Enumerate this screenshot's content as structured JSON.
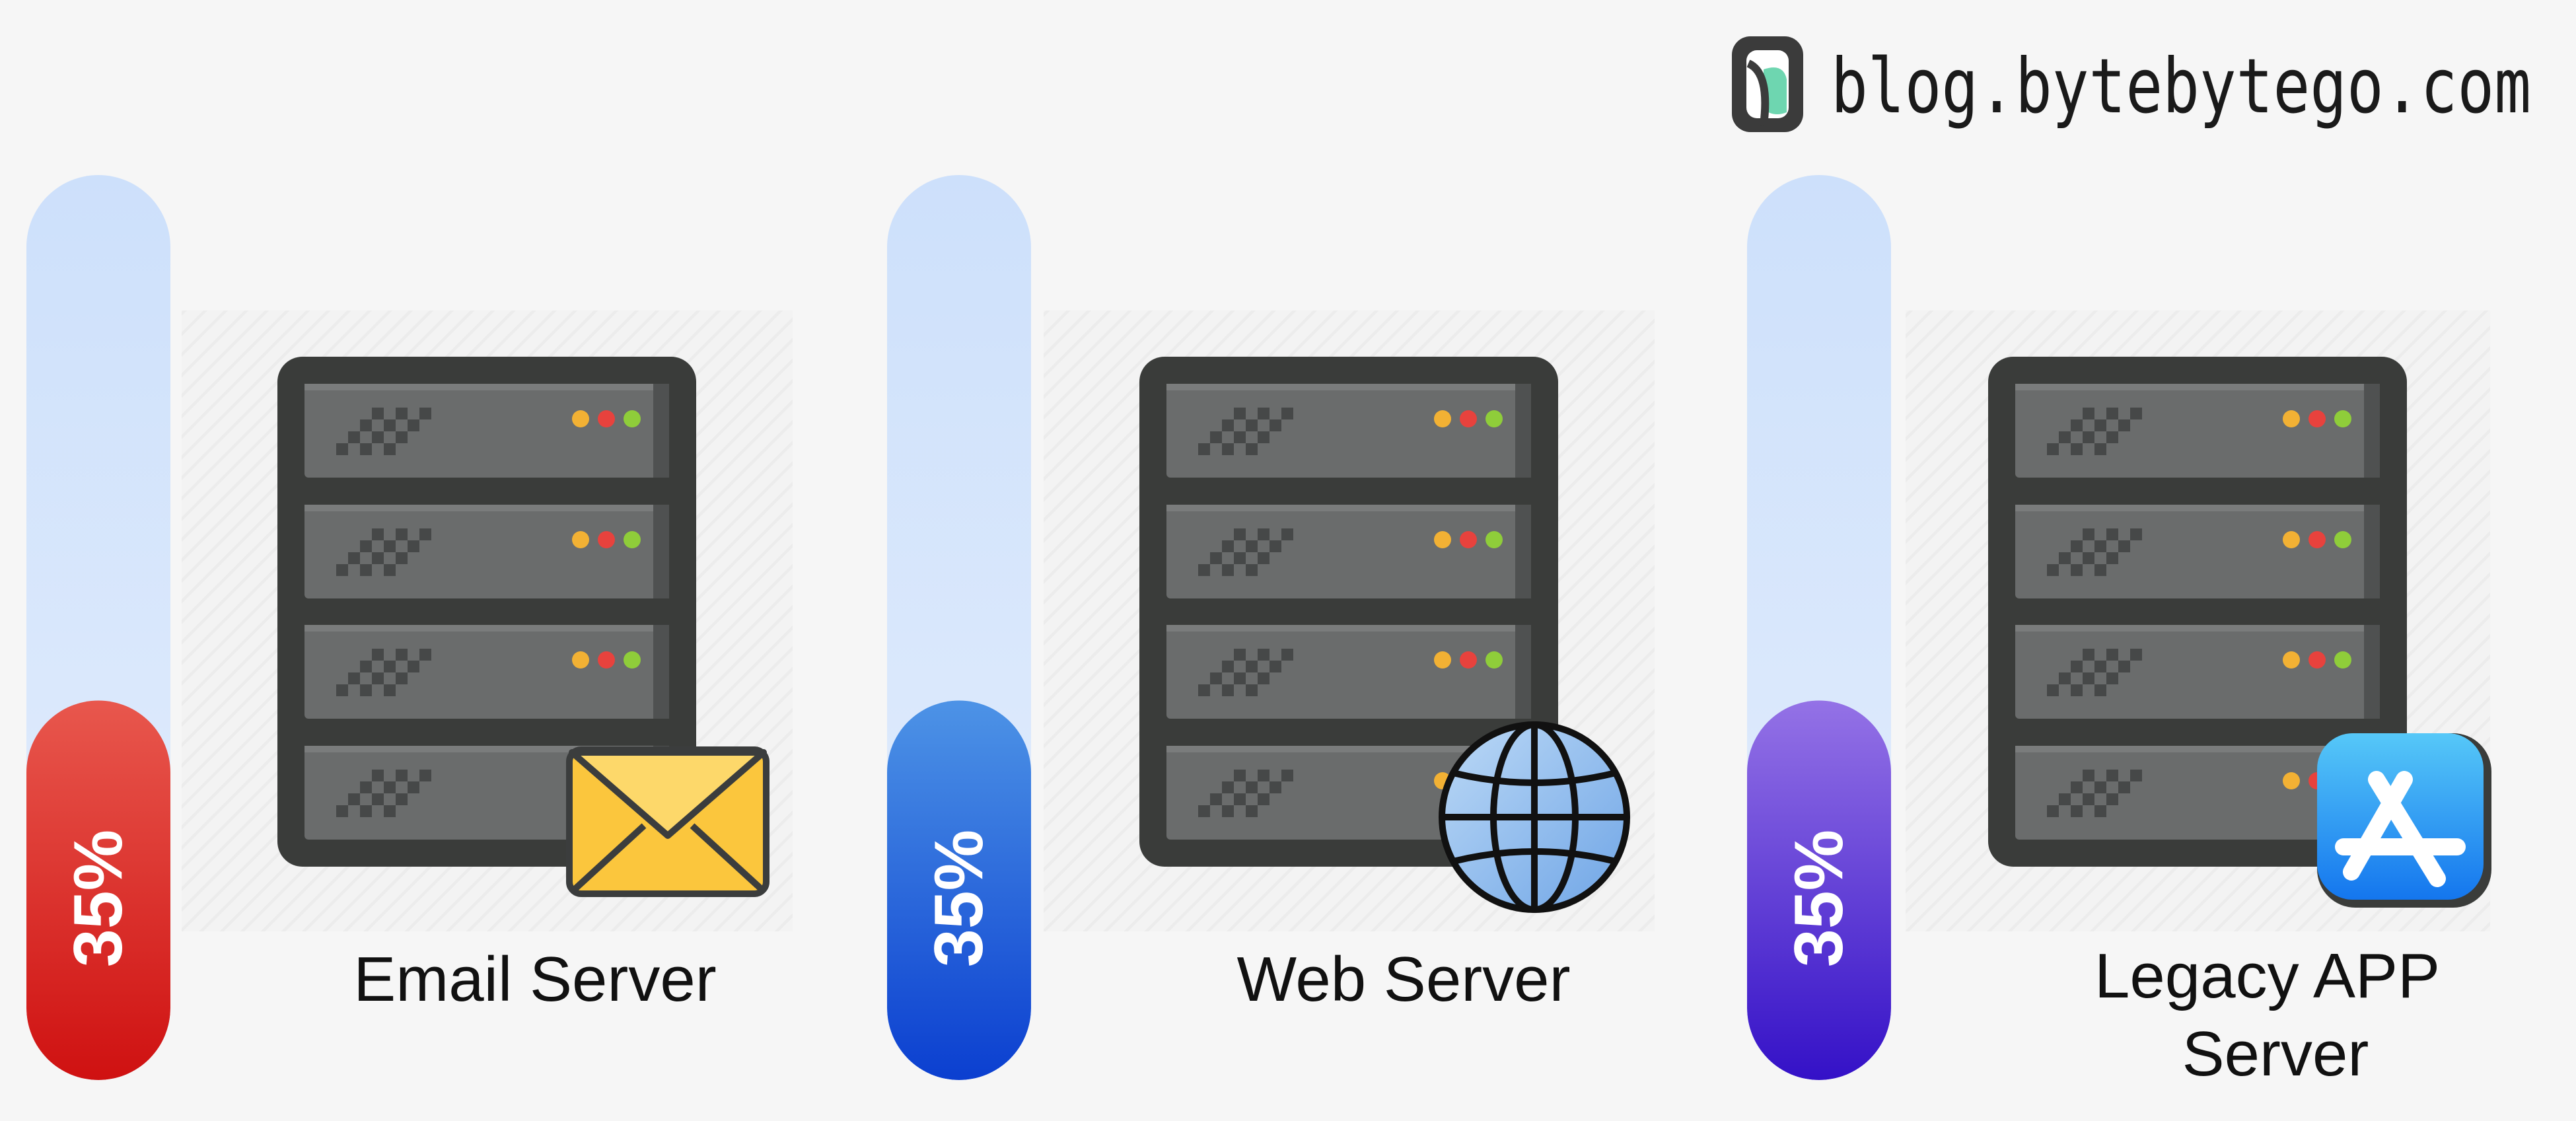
{
  "brand": {
    "site": "blog.bytebytego.com",
    "logo_icon": "bytebytego-logo-icon"
  },
  "servers": [
    {
      "label_lines": [
        "Email Server"
      ],
      "utilization_label": "35%",
      "utilization": 0.35,
      "gauge_fill_top": "#e8574d",
      "gauge_fill_bottom": "#cf1111",
      "badge_icon": "envelope-icon"
    },
    {
      "label_lines": [
        "Web Server"
      ],
      "utilization_label": "35%",
      "utilization": 0.35,
      "gauge_fill_top": "#4d93e6",
      "gauge_fill_bottom": "#0b3fd0",
      "badge_icon": "globe-icon"
    },
    {
      "label_lines": [
        "Legacy APP",
        "Server"
      ],
      "utilization_label": "35%",
      "utilization": 0.35,
      "gauge_fill_top": "#9472e6",
      "gauge_fill_bottom": "#3411c7",
      "badge_icon": "app-store-icon"
    }
  ],
  "colors": {
    "gauge_track_top": "#cde0fb",
    "gauge_track_bottom": "#e4eefc",
    "rack_frame": "#3a3c3a",
    "rack_unit": "#6a6c6c",
    "led_yellow": "#f2b134",
    "led_red": "#e8423d",
    "led_green": "#8fcd3a"
  }
}
